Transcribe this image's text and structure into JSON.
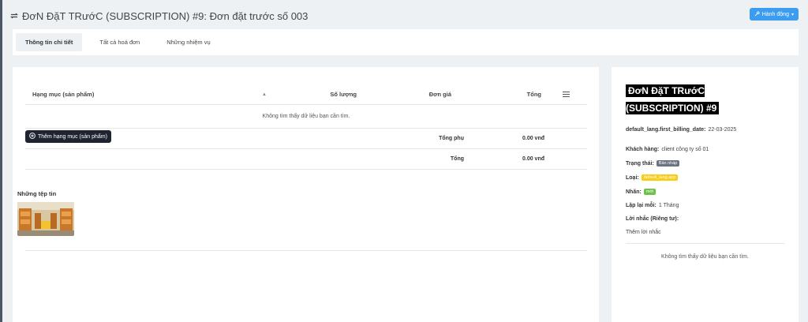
{
  "header": {
    "title": "ĐơN ĐặT TRướC (SUBSCRIPTION) #9: Đơn đặt trước số 003",
    "action_label": "Hành động",
    "icons": {
      "cycle": "refresh-cycle-icon",
      "action": "wrench-icon",
      "caret": "caret-down-icon"
    }
  },
  "tabs": [
    {
      "label": "Thông tin chi tiết",
      "active": true
    },
    {
      "label": "Tất cả hoá đơn",
      "active": false
    },
    {
      "label": "Những nhiệm vụ",
      "active": false
    }
  ],
  "table": {
    "headers": {
      "item": "Hạng mục (sản phẩm)",
      "qty": "Số lượng",
      "price": "Đơn giá",
      "total": "Tổng"
    },
    "empty_text": "Không tìm thấy dữ liệu bạn cần tìm.",
    "add_item_label": "Thêm hạng mục (sản phẩm)",
    "subtotal_label": "Tổng phụ",
    "subtotal_value": "0.00 vnđ",
    "total_label": "Tổng",
    "total_value": "0.00 vnđ"
  },
  "files": {
    "title": "Những tệp tin"
  },
  "side": {
    "title": "ĐơN ĐặT TRướC (SUBSCRIPTION) #9",
    "billing_label": "default_lang.first_billing_date:",
    "billing_value": "22-03-2025",
    "client_label": "Khách hàng:",
    "client_value": "client công ty số 01",
    "status_label": "Trạng thái:",
    "status_value": "Bản nháp",
    "type_label": "Loại:",
    "type_value": "default_lang.app",
    "tag_label": "Nhãn:",
    "tag_value": "mới",
    "repeat_label": "Lặp lại mỗi:",
    "repeat_value": "1 Tháng",
    "note_label": "Lời nhắc (Riêng tư):",
    "add_note_label": "Thêm lời nhắc",
    "empty_text": "Không tìm thấy dữ liệu bạn cần tìm."
  },
  "colors": {
    "accent": "#3b9cf0",
    "dark_button": "#1f2430",
    "status_badge": "#6b7280",
    "type_badge": "#facc15",
    "tag_badge": "#6cc24a"
  }
}
